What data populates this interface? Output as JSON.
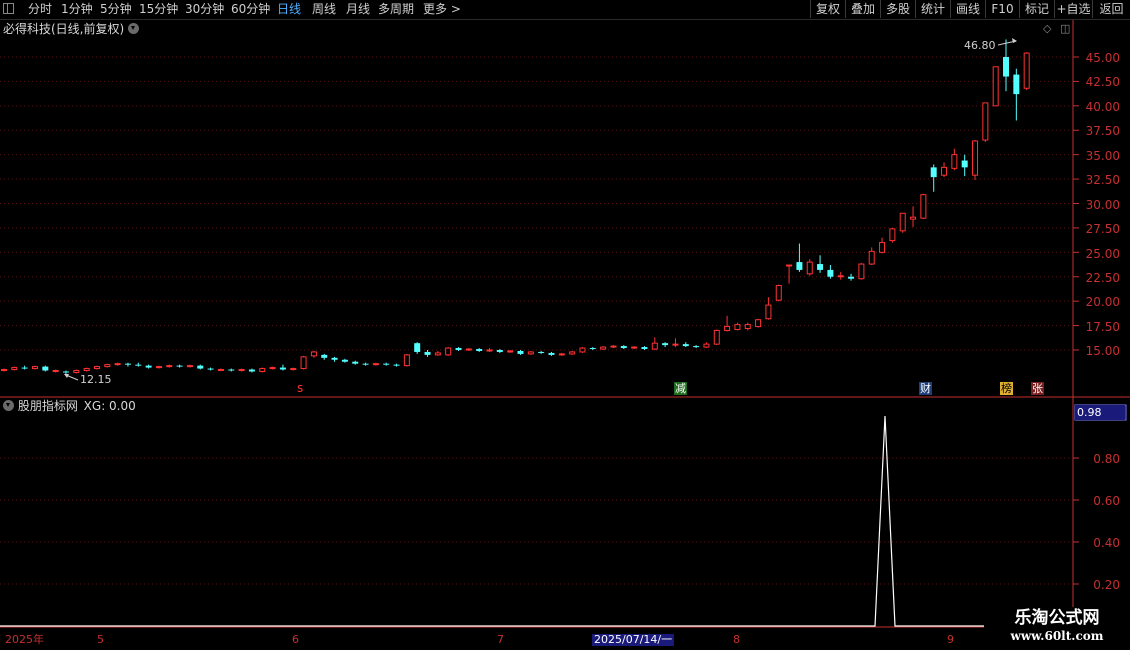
{
  "toolbar": {
    "left_items": [
      "分时",
      "1分钟",
      "5分钟",
      "15分钟",
      "30分钟",
      "60分钟",
      "日线",
      "周线",
      "月线",
      "多周期",
      "更多 >"
    ],
    "right_buttons": [
      "复权",
      "叠加",
      "多股",
      "统计",
      "画线",
      "F10",
      "标记",
      "+自选",
      "返回"
    ]
  },
  "main": {
    "title": "必得科技(日线,前复权)",
    "high_label": "46.80",
    "low_label": "12.15",
    "price_axis": [
      "45.00",
      "42.50",
      "40.00",
      "37.50",
      "35.00",
      "32.50",
      "30.00",
      "27.50",
      "25.00",
      "22.50",
      "20.00",
      "17.50",
      "15.00"
    ],
    "tags": {
      "s": "s",
      "jian": "减",
      "cai": "财",
      "bang": "榜",
      "zhang": "张"
    }
  },
  "sub": {
    "title": "股朋指标网",
    "indicator": "XG: 0.00",
    "current_value": "0.98",
    "axis": [
      "0.80",
      "0.60",
      "0.40",
      "0.20"
    ]
  },
  "dates": {
    "year": "2025年",
    "months": [
      "5",
      "6",
      "7",
      "8",
      "9"
    ],
    "cursor": "2025/07/14/一"
  },
  "watermark": {
    "name": "乐淘公式网",
    "url": "www.60lt.com"
  },
  "colors": {
    "up": "#ff3232",
    "down": "#54ffff",
    "axis": "#c43030",
    "grid": "#5a1515"
  }
}
